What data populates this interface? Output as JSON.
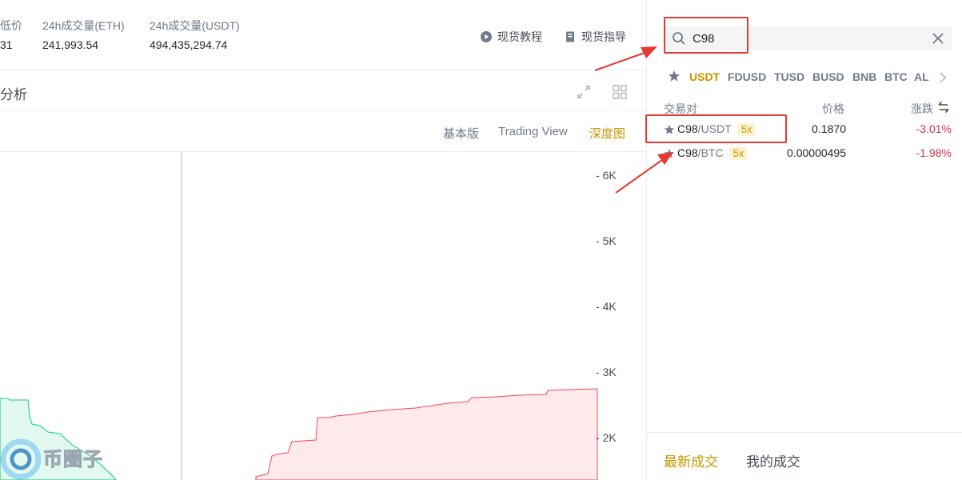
{
  "stats": [
    {
      "label": "低价",
      "value": "31"
    },
    {
      "label": "24h成交量(ETH)",
      "value": "241,993.54"
    },
    {
      "label": "24h成交量(USDT)",
      "value": "494,435,294.74"
    }
  ],
  "header_links": {
    "tutorial": "现货教程",
    "guide": "现货指导"
  },
  "analysis": {
    "title": "分析"
  },
  "chart_views": {
    "basic": "基本版",
    "tradingview": "Trading View",
    "depth": "深度图",
    "active": "深度图"
  },
  "chart_data": {
    "type": "area",
    "y_ticks": [
      "6K",
      "5K",
      "4K",
      "3K",
      "2K"
    ],
    "series": [
      {
        "name": "bids",
        "color": "#0ecb81"
      },
      {
        "name": "asks",
        "color": "#f6465d"
      }
    ]
  },
  "search": {
    "value": "C98",
    "placeholder": ""
  },
  "quote_tabs": [
    "USDT",
    "FDUSD",
    "TUSD",
    "BUSD",
    "BNB",
    "BTC",
    "AL"
  ],
  "quote_tab_active": "USDT",
  "table": {
    "headers": {
      "pair": "交易对",
      "price": "价格",
      "change": "涨跌"
    },
    "rows": [
      {
        "base": "C98",
        "quote": "/USDT",
        "leverage": "5x",
        "price": "0.1870",
        "change": "-3.01%"
      },
      {
        "base": "C98",
        "quote": "/BTC",
        "leverage": "5x",
        "price": "0.00000495",
        "change": "-1.98%"
      }
    ]
  },
  "trades_tabs": {
    "latest": "最新成交",
    "mine": "我的成交"
  },
  "watermark": "币圈子",
  "colors": {
    "accent": "#c99400",
    "down": "#cf304a",
    "bid": "#0ecb81",
    "ask": "#f6465d",
    "highlight": "#e53935"
  }
}
